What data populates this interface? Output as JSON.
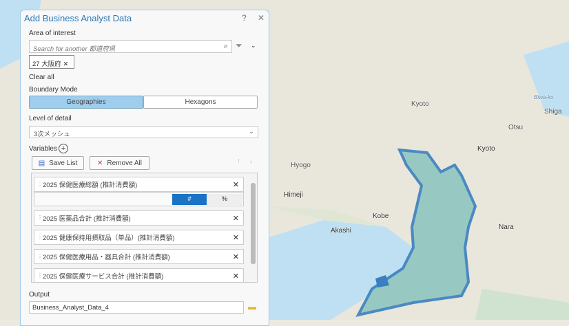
{
  "map": {
    "labels": [
      "Kyoto",
      "Biwa-ko",
      "Shiga",
      "Otsu",
      "Kyoto",
      "Hyogo",
      "Himeji",
      "Kobe",
      "Akashi",
      "Nara"
    ],
    "highlight_color": "#3a7fc0"
  },
  "panel": {
    "title": "Add Business Analyst Data",
    "help": "?",
    "close": "✕",
    "area_label": "Area of interest",
    "search_placeholder": "Search for another 都道府県",
    "chip": "27 大阪府",
    "clear_all": "Clear all",
    "boundary_label": "Boundary Mode",
    "modes": [
      "Geographies",
      "Hexagons"
    ],
    "detail_label": "Level of detail",
    "detail_value": "3次メッシュ",
    "variables_label": "Variables",
    "save_list": "Save List",
    "remove_all": "Remove All",
    "variables": [
      "2025 保健医療総額 (推計消費額)",
      "2025 医薬品合計 (推計消費額)",
      "2025 健康保持用摂取品（単品）(推計消費額)",
      "2025 保健医療用品・器具合計 (推計消費額)",
      "2025 保健医療サービス合計 (推計消費額)"
    ],
    "format": [
      "#",
      "%"
    ],
    "output_label": "Output",
    "output_value": "Business_Analyst_Data_4"
  }
}
